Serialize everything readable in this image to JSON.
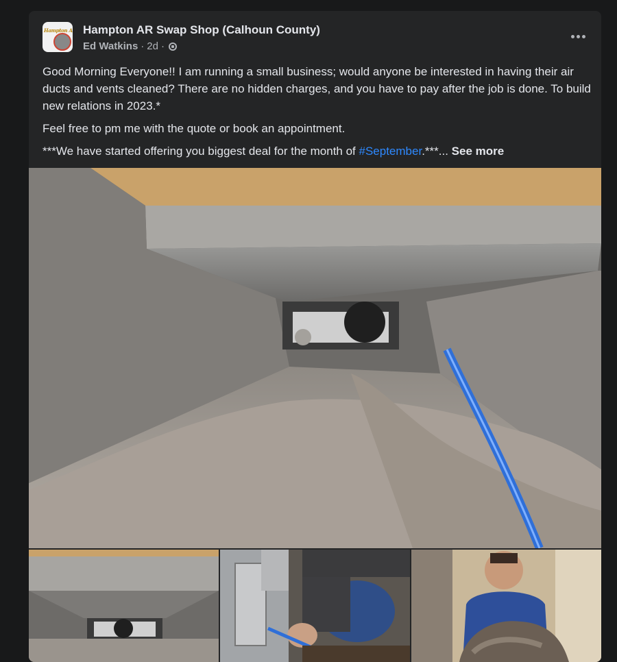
{
  "post": {
    "group_name": "Hampton AR Swap Shop (Calhoun County)",
    "author": "Ed Watkins",
    "separator": "·",
    "time": "2d",
    "avatar_text": "Hampton AR",
    "paragraphs": {
      "p1": "Good Morning Everyone!!  I am running a small business; would anyone be interested in having their air ducts and vents cleaned? There are no hidden charges, and you have to pay after the job is done. To build new relations in 2023.*",
      "p2": "Feel free to pm me with the quote or book an appointment.",
      "p3_before": "***We have started offering you biggest deal for the month of ",
      "hashtag": "#September",
      "p3_after": ".***... ",
      "see_more": "See more"
    }
  },
  "icons": {
    "privacy": "globe-icon",
    "menu": "more-horizontal-icon"
  },
  "colors": {
    "background": "#18191a",
    "card": "#242526",
    "text_primary": "#e4e6eb",
    "text_secondary": "#b0b3b8",
    "link": "#2e89ff"
  }
}
